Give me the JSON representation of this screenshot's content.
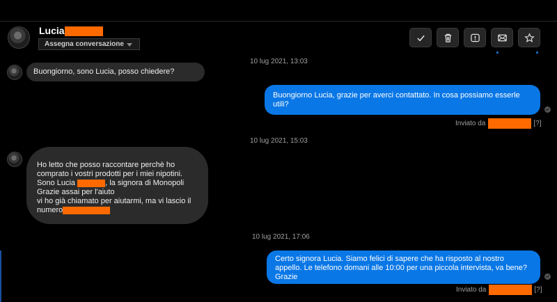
{
  "header": {
    "contact_name": "Lucia",
    "assign_label": "Assegna conversazione",
    "actions": [
      {
        "name": "resolve-button",
        "icon": "check-icon"
      },
      {
        "name": "delete-button",
        "icon": "trash-icon"
      },
      {
        "name": "report-button",
        "icon": "alert-icon"
      },
      {
        "name": "email-button",
        "icon": "envelope-icon"
      },
      {
        "name": "star-button",
        "icon": "star-icon"
      }
    ]
  },
  "colors": {
    "outgoing_bubble": "#0a77e6",
    "incoming_bubble": "#2b2b2b",
    "redaction": "#ff6a00",
    "background": "#000000"
  },
  "messages": [
    {
      "type": "timestamp",
      "text": "10 lug 2021, 13:03"
    },
    {
      "type": "incoming",
      "text": "Buongiorno, sono Lucia, posso chiedere?"
    },
    {
      "type": "outgoing",
      "text": "Buongiorno Lucia, grazie per averci contattato. In cosa possiamo esserle utili?",
      "sent_by_label": "Inviato da",
      "help": "[?]"
    },
    {
      "type": "timestamp",
      "text": "10 lug 2021, 15:03"
    },
    {
      "type": "incoming",
      "lines": [
        "Ho letto che posso raccontare perchè ho",
        "comprato i vostri prodotti per i miei nipotini.",
        "Sono Lucia",
        ", la signora di Monopoli",
        "Grazie assai per l'aiuto",
        "vi ho già chiamato per aiutarmi, ma vi lascio il",
        "numero"
      ]
    },
    {
      "type": "timestamp",
      "text": "10 lug 2021, 17:06"
    },
    {
      "type": "outgoing",
      "text": "Certo signora Lucia. Siamo felici di sapere che ha risposto al nostro appello. Le telefono domani alle 10:00 per una piccola intervista, va bene? Grazie",
      "sent_by_label": "Inviato da",
      "help": "[?]"
    }
  ]
}
